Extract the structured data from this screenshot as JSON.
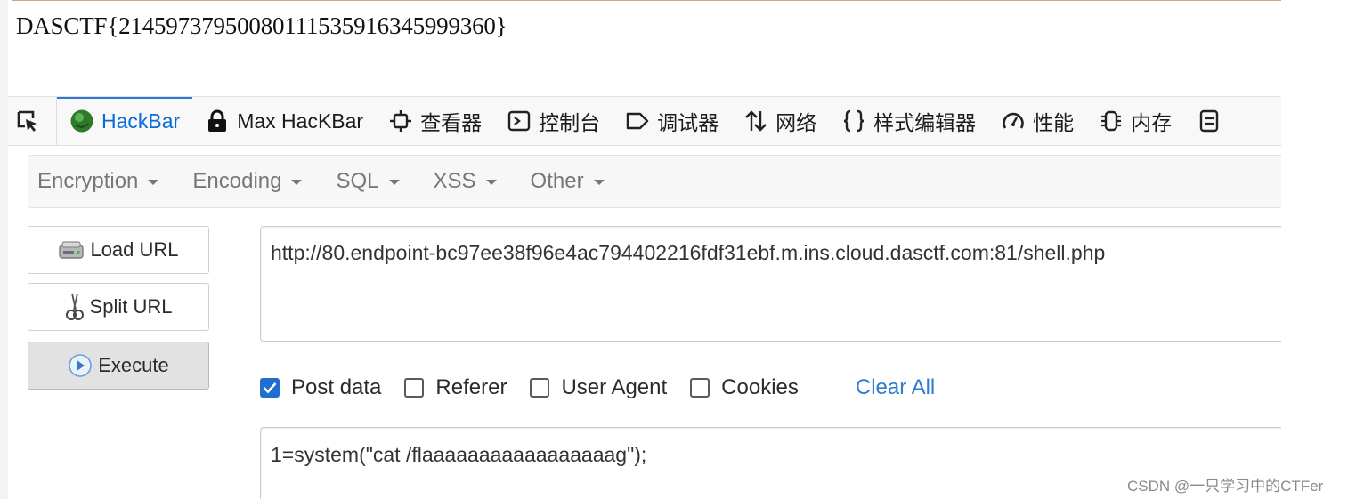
{
  "page": {
    "flag": "DASCTF{21459737950080111535916345999360}",
    "watermark": "CSDN @一只学习中的CTFer"
  },
  "devtools": {
    "tabs": [
      {
        "label": "HackBar",
        "icon": "hackbar-logo-icon",
        "active": true
      },
      {
        "label": "Max HacKBar",
        "icon": "lock-icon"
      },
      {
        "label": "查看器",
        "icon": "inspector-icon"
      },
      {
        "label": "控制台",
        "icon": "console-icon"
      },
      {
        "label": "调试器",
        "icon": "debugger-icon"
      },
      {
        "label": "网络",
        "icon": "network-arrows-icon"
      },
      {
        "label": "样式编辑器",
        "icon": "braces-icon"
      },
      {
        "label": "性能",
        "icon": "gauge-icon"
      },
      {
        "label": "内存",
        "icon": "memory-chip-icon"
      }
    ],
    "accent_color": "#0a6ad6"
  },
  "hackbar": {
    "menu": [
      {
        "label": "Encryption"
      },
      {
        "label": "Encoding"
      },
      {
        "label": "SQL"
      },
      {
        "label": "XSS"
      },
      {
        "label": "Other"
      }
    ],
    "buttons": {
      "load": "Load URL",
      "split": "Split URL",
      "execute": "Execute"
    },
    "url": "http://80.endpoint-bc97ee38f96e4ac794402216fdf31ebf.m.ins.cloud.dasctf.com:81/shell.php",
    "options": [
      {
        "label": "Post data",
        "checked": true
      },
      {
        "label": "Referer",
        "checked": false
      },
      {
        "label": "User Agent",
        "checked": false
      },
      {
        "label": "Cookies",
        "checked": false
      }
    ],
    "clear_all": "Clear All",
    "post_body": "1=system(\"cat /flaaaaaaaaaaaaaaaaag\");"
  }
}
